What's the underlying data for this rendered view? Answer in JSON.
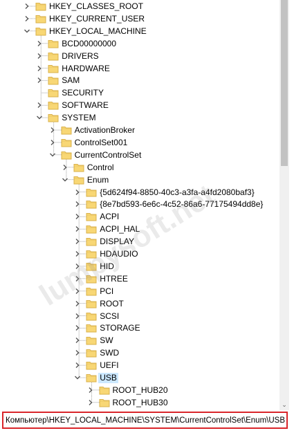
{
  "tree": [
    {
      "label": "HKEY_CLASSES_ROOT",
      "level": 0,
      "state": "collapsed"
    },
    {
      "label": "HKEY_CURRENT_USER",
      "level": 0,
      "state": "collapsed"
    },
    {
      "label": "HKEY_LOCAL_MACHINE",
      "level": 0,
      "state": "expanded"
    },
    {
      "label": "BCD00000000",
      "level": 1,
      "state": "collapsed"
    },
    {
      "label": "DRIVERS",
      "level": 1,
      "state": "collapsed"
    },
    {
      "label": "HARDWARE",
      "level": 1,
      "state": "collapsed"
    },
    {
      "label": "SAM",
      "level": 1,
      "state": "collapsed"
    },
    {
      "label": "SECURITY",
      "level": 1,
      "state": "leaf"
    },
    {
      "label": "SOFTWARE",
      "level": 1,
      "state": "collapsed"
    },
    {
      "label": "SYSTEM",
      "level": 1,
      "state": "expanded"
    },
    {
      "label": "ActivationBroker",
      "level": 2,
      "state": "collapsed"
    },
    {
      "label": "ControlSet001",
      "level": 2,
      "state": "collapsed"
    },
    {
      "label": "CurrentControlSet",
      "level": 2,
      "state": "expanded"
    },
    {
      "label": "Control",
      "level": 3,
      "state": "collapsed"
    },
    {
      "label": "Enum",
      "level": 3,
      "state": "expanded"
    },
    {
      "label": "{5d624f94-8850-40c3-a3fa-a4fd2080baf3}",
      "level": 4,
      "state": "collapsed"
    },
    {
      "label": "{8e7bd593-6e6c-4c52-86a6-77175494dd8e}",
      "level": 4,
      "state": "collapsed"
    },
    {
      "label": "ACPI",
      "level": 4,
      "state": "collapsed"
    },
    {
      "label": "ACPI_HAL",
      "level": 4,
      "state": "collapsed"
    },
    {
      "label": "DISPLAY",
      "level": 4,
      "state": "collapsed"
    },
    {
      "label": "HDAUDIO",
      "level": 4,
      "state": "collapsed"
    },
    {
      "label": "HID",
      "level": 4,
      "state": "collapsed"
    },
    {
      "label": "HTREE",
      "level": 4,
      "state": "collapsed"
    },
    {
      "label": "PCI",
      "level": 4,
      "state": "collapsed"
    },
    {
      "label": "ROOT",
      "level": 4,
      "state": "collapsed"
    },
    {
      "label": "SCSI",
      "level": 4,
      "state": "collapsed"
    },
    {
      "label": "STORAGE",
      "level": 4,
      "state": "collapsed"
    },
    {
      "label": "SW",
      "level": 4,
      "state": "collapsed"
    },
    {
      "label": "SWD",
      "level": 4,
      "state": "collapsed"
    },
    {
      "label": "UEFI",
      "level": 4,
      "state": "collapsed"
    },
    {
      "label": "USB",
      "level": 4,
      "state": "expanded",
      "selected": true
    },
    {
      "label": "ROOT_HUB20",
      "level": 5,
      "state": "collapsed"
    },
    {
      "label": "ROOT_HUB30",
      "level": 5,
      "state": "collapsed"
    }
  ],
  "colors": {
    "folder_fill": "#f8d775",
    "folder_edge": "#d9b04a",
    "selection": "#cce8ff",
    "highlight_border": "#d9252a"
  },
  "status_bar": {
    "path": "Компьютер\\HKEY_LOCAL_MACHINE\\SYSTEM\\CurrentControlSet\\Enum\\USB"
  },
  "scrollbar": {
    "down_arrow_icon": "chevron-down-icon"
  },
  "watermark": {
    "text": "lumpysoft.net"
  }
}
